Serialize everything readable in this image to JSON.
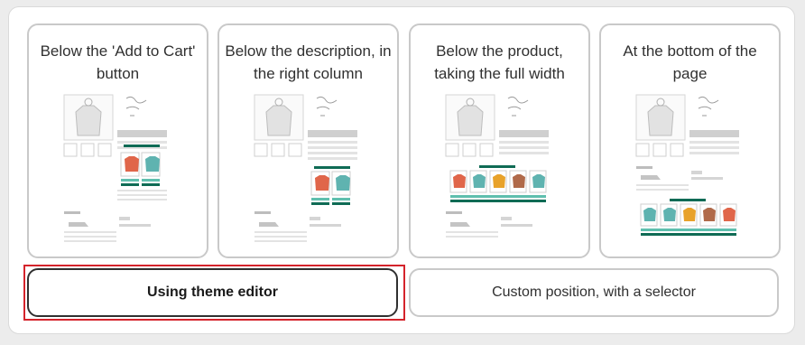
{
  "colors": {
    "selected_border": "#303030",
    "focus_outline": "#d4232b",
    "card_border": "#c9c9c9",
    "widget_header": "#0f6b55",
    "widget_stripe": "#5fbfae"
  },
  "options": [
    {
      "title": "Below the 'Add to Cart' button",
      "preview": "below-add-to-cart-preview"
    },
    {
      "title": "Below the description, in the right column",
      "preview": "below-description-preview"
    },
    {
      "title": "Below the product, taking the full width",
      "preview": "below-product-full-width-preview"
    },
    {
      "title": "At the bottom of the page",
      "preview": "bottom-of-page-preview"
    }
  ],
  "methods": {
    "theme_editor_label": "Using theme editor",
    "custom_position_label": "Custom position, with a selector",
    "selected": "theme_editor"
  }
}
